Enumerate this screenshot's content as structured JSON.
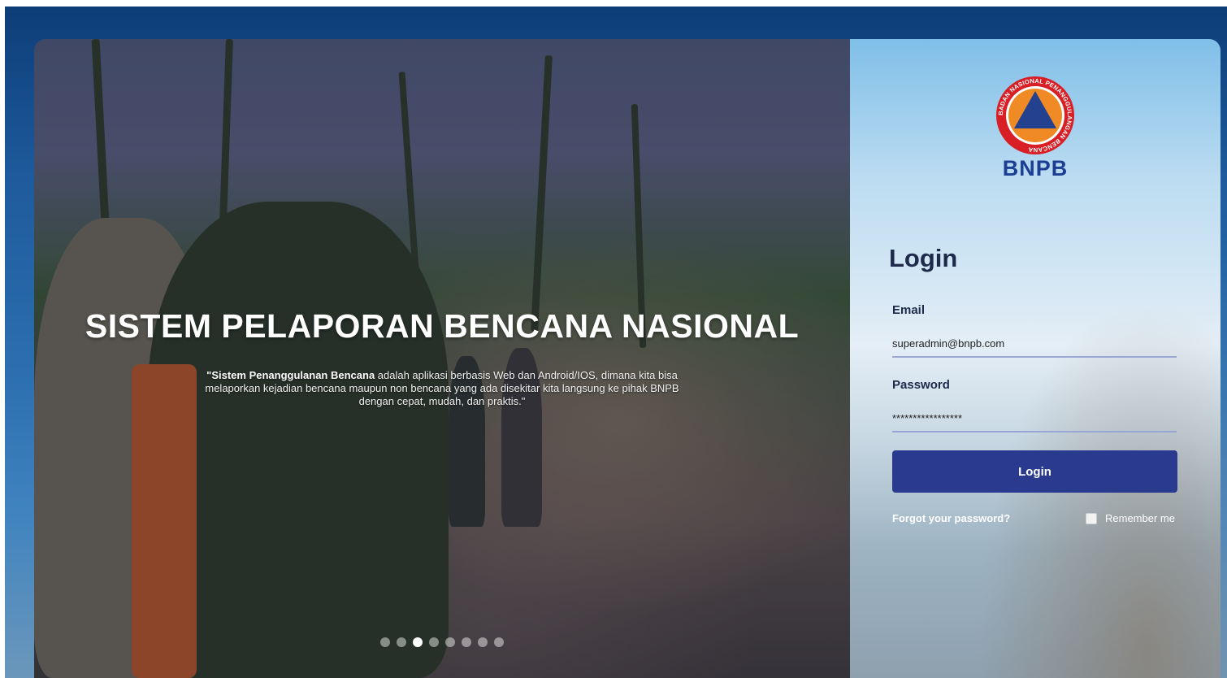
{
  "hero": {
    "title": "SISTEM PELAPORAN BENCANA NASIONAL",
    "desc_bold": "\"Sistem Penanggulanan Bencana",
    "desc_rest": " adalah aplikasi berbasis Web dan Android/IOS, dimana kita bisa melaporkan kejadian bencana maupun non bencana yang ada disekitar kita langsung ke pihak BNPB dengan cepat, mudah, dan praktis.\"",
    "slide_count": 8,
    "active_slide": 3
  },
  "logo": {
    "name": "BNPB",
    "ring_text": "BADAN NASIONAL PENANGGULANGAN BENCANA"
  },
  "login": {
    "title": "Login",
    "email_label": "Email",
    "email_value": "superadmin@bnpb.com",
    "password_label": "Password",
    "password_value": "*****************",
    "button": "Login",
    "forgot": "Forgot your password?",
    "remember": "Remember me"
  },
  "colors": {
    "button": "#2a3a8f",
    "brand": "#1c3f94",
    "logo_orange": "#f08a24",
    "logo_red": "#d81f26"
  }
}
